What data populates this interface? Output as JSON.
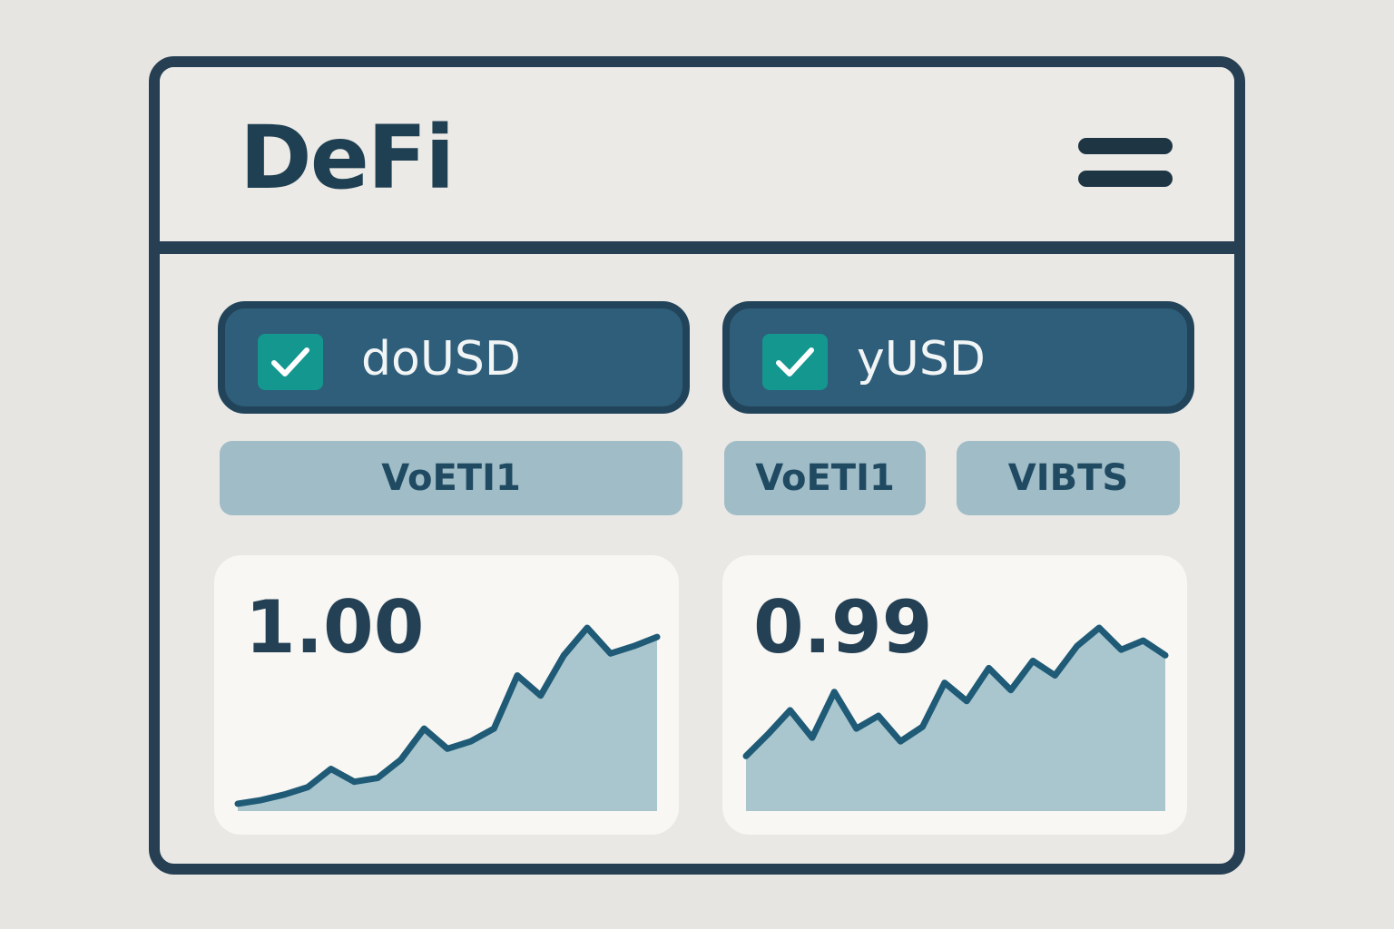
{
  "app": {
    "title": "DeFi"
  },
  "menu": {
    "icon": "hamburger-menu-icon"
  },
  "tokens": [
    {
      "label": "doUSD",
      "checked": true,
      "chips": [
        "VoETI1"
      ],
      "value": "1.00",
      "trend": [
        0.04,
        0.06,
        0.09,
        0.13,
        0.23,
        0.16,
        0.18,
        0.28,
        0.45,
        0.34,
        0.38,
        0.45,
        0.74,
        0.63,
        0.85,
        1.0,
        0.86,
        0.9,
        0.95
      ]
    },
    {
      "label": "yUSD",
      "checked": true,
      "chips": [
        "VoETI1",
        "VIBTS"
      ],
      "value": "0.99",
      "trend": [
        0.3,
        0.42,
        0.55,
        0.4,
        0.65,
        0.45,
        0.52,
        0.38,
        0.46,
        0.7,
        0.6,
        0.78,
        0.66,
        0.82,
        0.74,
        0.9,
        1.0,
        0.88,
        0.93,
        0.85
      ]
    }
  ],
  "colors": {
    "accent": "#14978f",
    "toggle_bg": "#2e5e7a",
    "chip_bg": "#9fbcc7",
    "chart_line": "#1f5a76",
    "chart_fill": "#a9c6ce",
    "frame": "#263f52"
  }
}
